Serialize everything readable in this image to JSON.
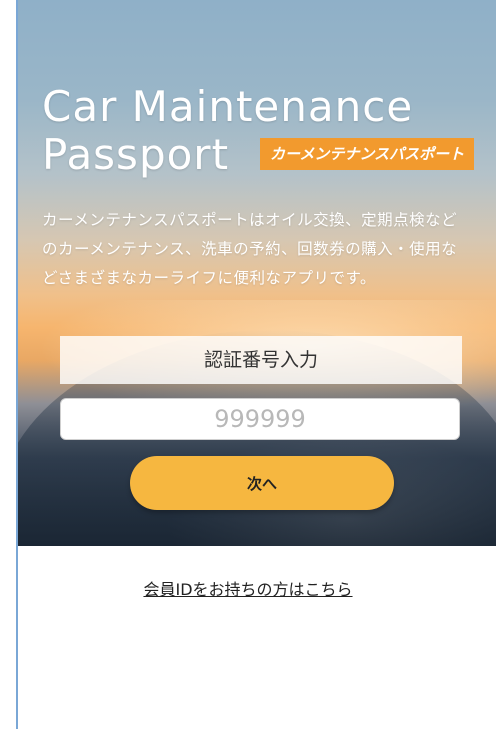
{
  "logo": {
    "line1": "Car Maintenance",
    "line2": "Passport",
    "badge": "カーメンテナンスパスポート"
  },
  "description": "カーメンテナンスパスポートはオイル交換、定期点検などのカーメンテナンス、洗車の予約、回数券の購入・使用などさまざまなカーライフに便利なアプリです。",
  "auth": {
    "label": "認証番号入力",
    "placeholder": "999999",
    "next_label": "次へ"
  },
  "member_link": "会員IDをお持ちの方はこちら",
  "colors": {
    "accent_button": "#f6b740",
    "badge_orange": "#f29a2e"
  }
}
